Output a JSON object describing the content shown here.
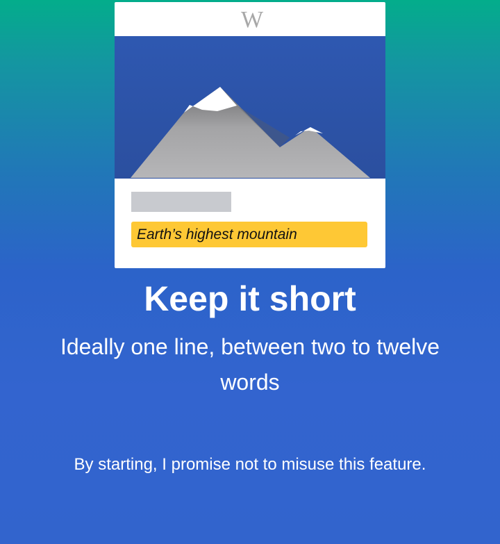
{
  "illustration": {
    "logo_letter": "W",
    "highlight_text": "Earth’s highest mountain",
    "colors": {
      "sky": "#2d56a8",
      "mountain": "#a9a9ab",
      "snow": "#ffffff",
      "highlight": "#fec835",
      "placeholder": "#c8cacf"
    }
  },
  "onboarding": {
    "heading": "Keep it short",
    "subtitle": "Ideally one line, between two to twelve words",
    "footer_note": "By starting, I promise not to misuse this feature."
  },
  "colors": {
    "background_top": "#03ad8b",
    "background_bottom": "#3264cd",
    "text": "#ffffff"
  }
}
